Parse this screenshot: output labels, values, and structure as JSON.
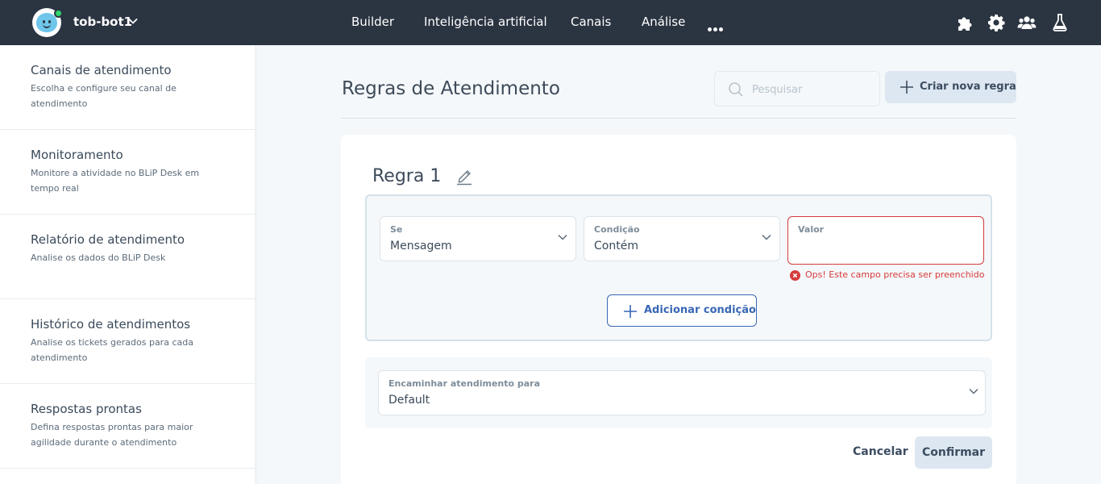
{
  "topbar": {
    "bot_name": "tob-bot1",
    "status_color": "#2fd672",
    "nav": [
      "Builder",
      "Inteligência artificial",
      "Canais",
      "Análise"
    ],
    "icons": [
      "puzzle-icon",
      "gear-icon",
      "team-icon",
      "flask-icon"
    ]
  },
  "sidebar": {
    "items": [
      {
        "title": "Canais de atendimento",
        "desc": "Escolha e configure seu canal de atendimento"
      },
      {
        "title": "Monitoramento",
        "desc": "Monitore a atividade no BLiP Desk em tempo real"
      },
      {
        "title": "Relatório de atendimento",
        "desc": "Analise os dados do BLiP Desk"
      },
      {
        "title": "Histórico de atendimentos",
        "desc": "Analise os tickets gerados para cada atendimento"
      },
      {
        "title": "Respostas prontas",
        "desc": "Defina respostas prontas para maior agilidade durante o atendimento"
      }
    ]
  },
  "main": {
    "title": "Regras de Atendimento",
    "search_placeholder": "Pesquisar",
    "new_rule_label": "Criar nova regra"
  },
  "rule": {
    "title": "Regra 1",
    "conditions": {
      "se_label": "Se",
      "se_value": "Mensagem",
      "condicao_label": "Condição",
      "condicao_value": "Contém",
      "valor_label": "Valor",
      "valor_value": "",
      "error": "Ops! Este campo precisa ser preenchido",
      "add_label": "Adicionar condição"
    },
    "route": {
      "label": "Encaminhar atendimento para",
      "value": "Default"
    },
    "cancel_label": "Cancelar",
    "confirm_label": "Confirmar"
  },
  "colors": {
    "topbar": "#2b3441",
    "accent": "#3867b5",
    "error": "#d43b3b",
    "button_bg": "#dde7f1"
  }
}
